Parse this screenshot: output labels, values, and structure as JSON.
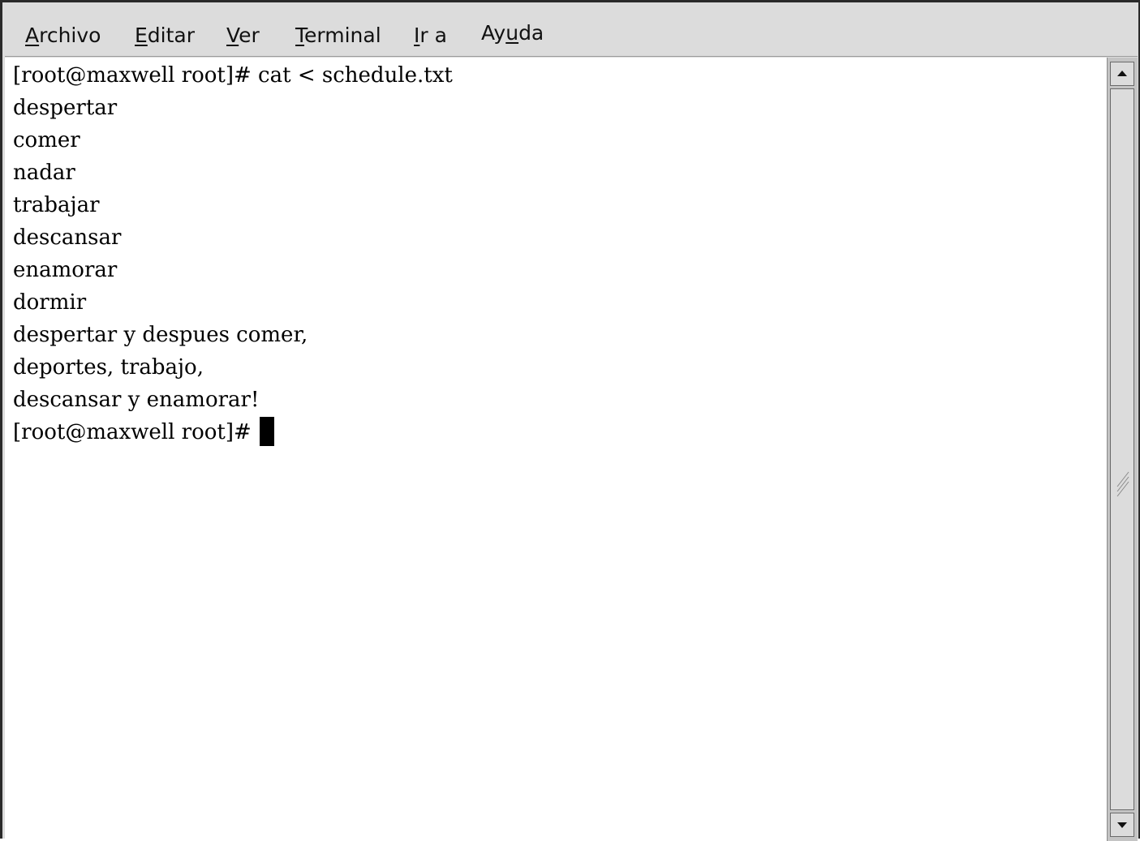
{
  "menubar": {
    "items": [
      {
        "mnemonic": "A",
        "rest": "rchivo"
      },
      {
        "mnemonic": "E",
        "rest": "ditar"
      },
      {
        "mnemonic": "V",
        "rest": "er"
      },
      {
        "mnemonic": "T",
        "rest": "erminal"
      },
      {
        "mnemonic": "I",
        "rest": "r a"
      },
      {
        "pre": "Ay",
        "mnemonic": "u",
        "rest": "da"
      }
    ]
  },
  "terminal": {
    "lines": [
      "[root@maxwell root]# cat < schedule.txt",
      "despertar",
      "comer",
      "nadar",
      "trabajar",
      "descansar",
      "enamorar",
      "dormir",
      "despertar y despues comer,",
      "deportes, trabajo,",
      "descansar y enamorar!"
    ],
    "prompt": "[root@maxwell root]# "
  },
  "colors": {
    "background": "#ffffff",
    "text": "#000000",
    "chrome": "#dcdcdc"
  }
}
